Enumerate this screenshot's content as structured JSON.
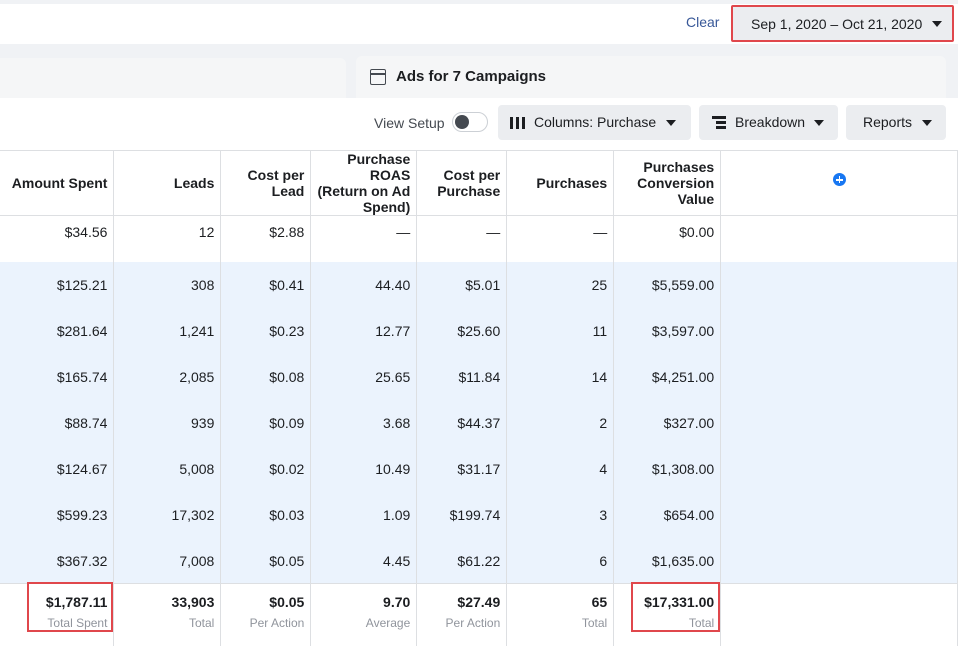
{
  "topbar": {
    "clear_label": "Clear",
    "date_range": "Sep 1, 2020 – Oct 21, 2020"
  },
  "panel": {
    "title": "Ads for 7 Campaigns"
  },
  "toolbar": {
    "view_setup_label": "View Setup",
    "view_setup_on": false,
    "columns_label": "Columns: Purchase",
    "breakdown_label": "Breakdown",
    "reports_label": "Reports"
  },
  "table": {
    "headers": {
      "amount_spent": "Amount Spent",
      "leads": "Leads",
      "cost_per_lead": "Cost per Lead",
      "purchase_roas": "Purchase ROAS (Return on Ad Spend)",
      "cost_per_purchase": "Cost per Purchase",
      "purchases": "Purchases",
      "conversion_value": "Purchases Conversion Value"
    },
    "rows": [
      [
        "$34.56",
        "12",
        "$2.88",
        "—",
        "—",
        "—",
        "$0.00"
      ],
      [
        "$125.21",
        "308",
        "$0.41",
        "44.40",
        "$5.01",
        "25",
        "$5,559.00"
      ],
      [
        "$281.64",
        "1,241",
        "$0.23",
        "12.77",
        "$25.60",
        "11",
        "$3,597.00"
      ],
      [
        "$165.74",
        "2,085",
        "$0.08",
        "25.65",
        "$11.84",
        "14",
        "$4,251.00"
      ],
      [
        "$88.74",
        "939",
        "$0.09",
        "3.68",
        "$44.37",
        "2",
        "$327.00"
      ],
      [
        "$124.67",
        "5,008",
        "$0.02",
        "10.49",
        "$31.17",
        "4",
        "$1,308.00"
      ],
      [
        "$599.23",
        "17,302",
        "$0.03",
        "1.09",
        "$199.74",
        "3",
        "$654.00"
      ],
      [
        "$367.32",
        "7,008",
        "$0.05",
        "4.45",
        "$61.22",
        "6",
        "$1,635.00"
      ]
    ],
    "totals": [
      {
        "value": "$1,787.11",
        "label": "Total Spent"
      },
      {
        "value": "33,903",
        "label": "Total"
      },
      {
        "value": "$0.05",
        "label": "Per Action"
      },
      {
        "value": "9.70",
        "label": "Average"
      },
      {
        "value": "$27.49",
        "label": "Per Action"
      },
      {
        "value": "65",
        "label": "Total"
      },
      {
        "value": "$17,331.00",
        "label": "Total"
      }
    ]
  },
  "colors": {
    "highlight_box": "#e0474c",
    "row_highlight": "#ebf3fd",
    "link": "#385898",
    "accent": "#1877f2"
  }
}
